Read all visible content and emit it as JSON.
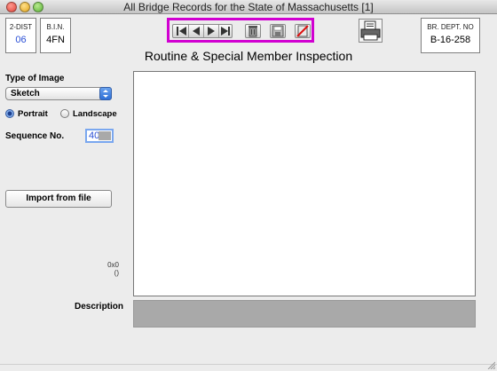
{
  "window": {
    "title": "All Bridge Records for the State of Massachusetts [1]"
  },
  "header": {
    "district_label": "2-DIST",
    "district_value": "06",
    "bin_label": "B.I.N.",
    "bin_value": "4FN",
    "dept_label": "BR. DEPT. NO",
    "dept_value": "B-16-258"
  },
  "toolbar": {
    "icons": [
      "first-record-icon",
      "previous-record-icon",
      "next-record-icon",
      "last-record-icon",
      "delete-trash-icon",
      "save-disk-icon",
      "cancel-edit-icon"
    ],
    "highlight_color": "#d100d1"
  },
  "form": {
    "title": "Routine & Special Member Inspection",
    "type_label": "Type of Image",
    "type_value": "Sketch",
    "orientation_options": [
      "Portrait",
      "Landscape"
    ],
    "orientation_selected": "Portrait",
    "sequence_label": "Sequence No.",
    "sequence_value": "40",
    "import_button": "Import from file",
    "image_dims": "0x0",
    "image_dims_sub": "()",
    "description_label": "Description"
  }
}
